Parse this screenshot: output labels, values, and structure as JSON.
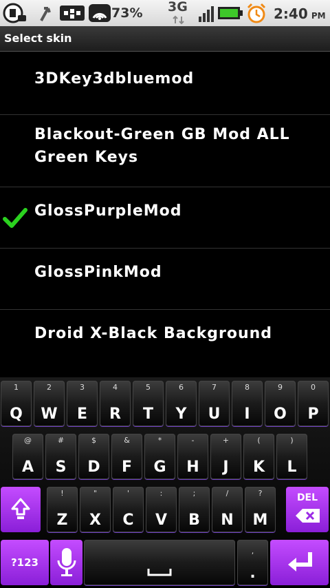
{
  "status_bar": {
    "battery_percent": "73%",
    "network": "3G",
    "time": "2:40",
    "ampm": "PM",
    "icons": [
      "voicemail-icon",
      "usb-icon",
      "bbm-icon",
      "wifi-icon",
      "signal-icon",
      "battery-icon",
      "alarm-clock-icon"
    ]
  },
  "dialog": {
    "title": "Select skin",
    "items": [
      {
        "line1": "3DKey3dbluemod",
        "line2": "",
        "selected": false
      },
      {
        "line1": "Blackout-Green GB Mod ALL",
        "line2": "Green Keys",
        "selected": false
      },
      {
        "line1": "GlossPurpleMod",
        "line2": "",
        "selected": true
      },
      {
        "line1": "GlossPinkMod",
        "line2": "",
        "selected": false
      },
      {
        "line1": "Droid X-Black Background",
        "line2": "",
        "selected": false
      }
    ]
  },
  "keyboard": {
    "row1": [
      {
        "sup": "1",
        "main": "Q"
      },
      {
        "sup": "2",
        "main": "W"
      },
      {
        "sup": "3",
        "main": "E"
      },
      {
        "sup": "4",
        "main": "R"
      },
      {
        "sup": "5",
        "main": "T"
      },
      {
        "sup": "6",
        "main": "Y"
      },
      {
        "sup": "7",
        "main": "U"
      },
      {
        "sup": "8",
        "main": "I"
      },
      {
        "sup": "9",
        "main": "O"
      },
      {
        "sup": "0",
        "main": "P"
      }
    ],
    "row2": [
      {
        "sup": "@",
        "main": "A"
      },
      {
        "sup": "#",
        "main": "S"
      },
      {
        "sup": "$",
        "main": "D"
      },
      {
        "sup": "&",
        "main": "F"
      },
      {
        "sup": "*",
        "main": "G"
      },
      {
        "sup": "-",
        "main": "H"
      },
      {
        "sup": "+",
        "main": "J"
      },
      {
        "sup": "(",
        "main": "K"
      },
      {
        "sup": ")",
        "main": "L"
      }
    ],
    "row3": [
      {
        "sup": "!",
        "main": "Z"
      },
      {
        "sup": "\"",
        "main": "X"
      },
      {
        "sup": "'",
        "main": "C"
      },
      {
        "sup": ":",
        "main": "V"
      },
      {
        "sup": ";",
        "main": "B"
      },
      {
        "sup": "/",
        "main": "N"
      },
      {
        "sup": "?",
        "main": "M"
      }
    ],
    "symbols_label": "?123",
    "delete_label": "DEL",
    "period_sup": ",",
    "period_main": ".",
    "accent_color": "#b23cf2"
  }
}
